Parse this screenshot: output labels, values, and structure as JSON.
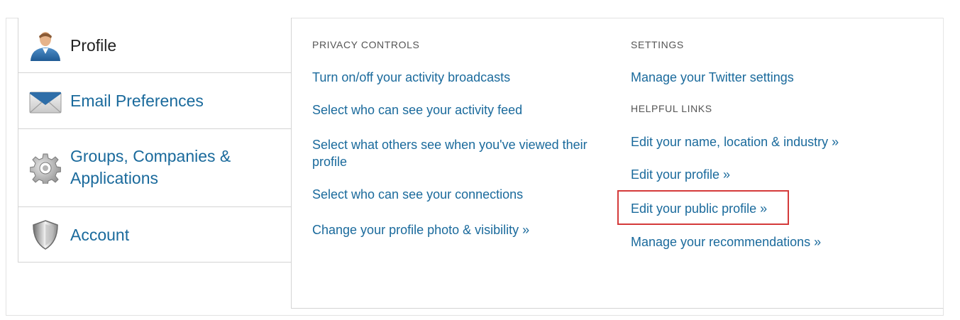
{
  "sidebar": {
    "items": [
      {
        "label": "Profile",
        "icon": "user-icon",
        "active": true
      },
      {
        "label": "Email Preferences",
        "icon": "envelope-icon",
        "active": false
      },
      {
        "label": "Groups, Companies & Applications",
        "icon": "gear-icon",
        "active": false
      },
      {
        "label": "Account",
        "icon": "shield-icon",
        "active": false
      }
    ]
  },
  "privacy_controls": {
    "heading": "PRIVACY CONTROLS",
    "links": [
      "Turn on/off your activity broadcasts",
      "Select who can see your activity feed",
      "Select what others see when you've viewed their profile",
      "Select who can see your connections",
      "Change your profile photo & visibility »"
    ]
  },
  "settings": {
    "heading": "SETTINGS",
    "links": [
      "Manage your Twitter settings"
    ]
  },
  "helpful_links": {
    "heading": "HELPFUL LINKS",
    "links": [
      "Edit your name, location & industry »",
      "Edit your profile »",
      "Edit your public profile »",
      "Manage your recommendations »"
    ]
  },
  "colors": {
    "link": "#1a6a9c",
    "highlight": "#d43a3a"
  }
}
